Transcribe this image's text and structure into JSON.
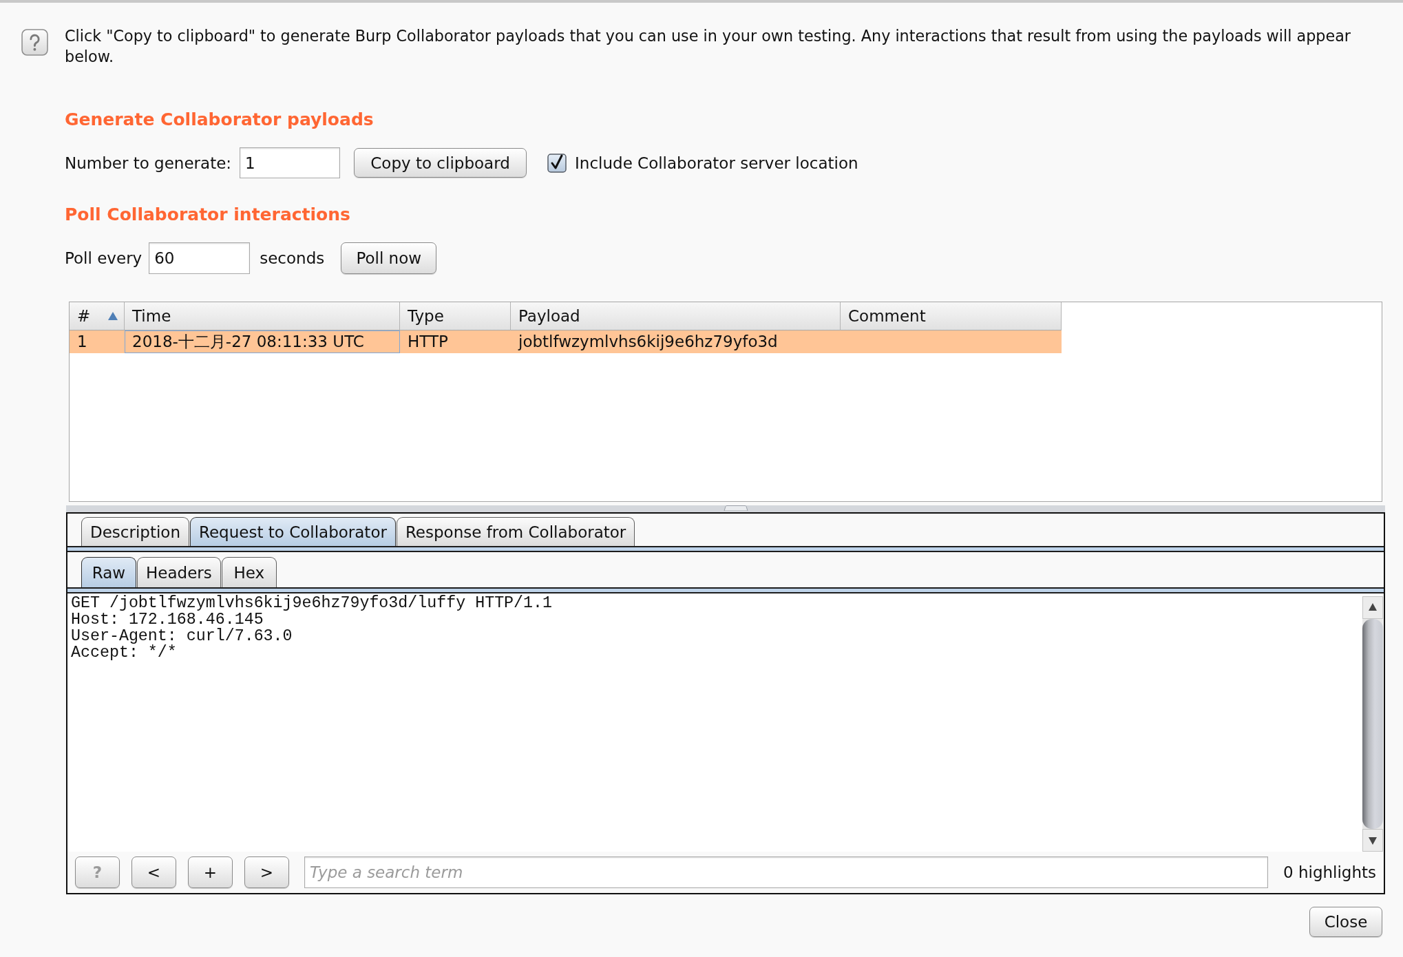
{
  "help_text": "Click \"Copy to clipboard\" to generate Burp Collaborator payloads that you can use in your own testing. Any interactions that result from using the payloads will appear below.",
  "generate": {
    "heading": "Generate Collaborator payloads",
    "number_label": "Number to generate:",
    "number_value": "1",
    "copy_button": "Copy to clipboard",
    "include_location": {
      "label": "Include Collaborator server location",
      "checked": true
    }
  },
  "poll": {
    "heading": "Poll Collaborator interactions",
    "label": "Poll every",
    "value": "60",
    "unit": "seconds",
    "button": "Poll now"
  },
  "table": {
    "columns": [
      {
        "label": "#",
        "sorted": true
      },
      {
        "label": "Time",
        "sorted": false
      },
      {
        "label": "Type",
        "sorted": false
      },
      {
        "label": "Payload",
        "sorted": false
      },
      {
        "label": "Comment",
        "sorted": false
      }
    ],
    "rows": [
      {
        "selected": true,
        "cells": [
          {
            "text": "1",
            "focused": false
          },
          {
            "text": "2018-十二月-27 08:11:33 UTC",
            "focused": true
          },
          {
            "text": "HTTP",
            "focused": false
          },
          {
            "text": "jobtlfwzymlvhs6kij9e6hz79yfo3d",
            "focused": false
          }
        ]
      }
    ]
  },
  "detail_tabs": [
    {
      "label": "Description",
      "selected": false
    },
    {
      "label": "Request to Collaborator",
      "selected": true
    },
    {
      "label": "Response from Collaborator",
      "selected": false
    }
  ],
  "view_tabs": [
    {
      "label": "Raw",
      "selected": true
    },
    {
      "label": "Headers",
      "selected": false
    },
    {
      "label": "Hex",
      "selected": false
    }
  ],
  "message_lines": [
    "GET /jobtlfwzymlvhs6kij9e6hz79yfo3d/luffy HTTP/1.1",
    "Host: 172.168.46.145",
    "User-Agent: curl/7.63.0",
    "Accept: */*"
  ],
  "search_bar": {
    "buttons": [
      {
        "label": "?",
        "disabled": true
      },
      {
        "label": "<",
        "disabled": false
      },
      {
        "label": "+",
        "disabled": false
      },
      {
        "label": ">",
        "disabled": false
      }
    ],
    "placeholder": "Type a search term",
    "highlights": "0 highlights"
  },
  "close_button": "Close"
}
